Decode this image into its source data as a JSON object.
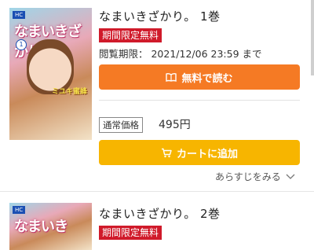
{
  "items": [
    {
      "title": "なまいきざかり。 1巻",
      "badge": "期間限定無料",
      "period": "閲覧期限：  2021/12/06 23:59 まで",
      "read_button": "無料で読む",
      "price_label": "通常価格",
      "price": "495円",
      "cart_button": "カートに追加",
      "synopsis": "あらすじをみる",
      "cover": {
        "logo": "HC",
        "title_art": "なまいきざかり",
        "volume": "1",
        "author": "ミユキ蜜蜂"
      }
    },
    {
      "title": "なまいきざかり。 2巻",
      "badge": "期間限定無料",
      "cover": {
        "logo": "HC",
        "title_art": "なまいき"
      }
    }
  ],
  "colors": {
    "badge": "#d01a2a",
    "read": "#f57a24",
    "cart": "#f7b500"
  }
}
